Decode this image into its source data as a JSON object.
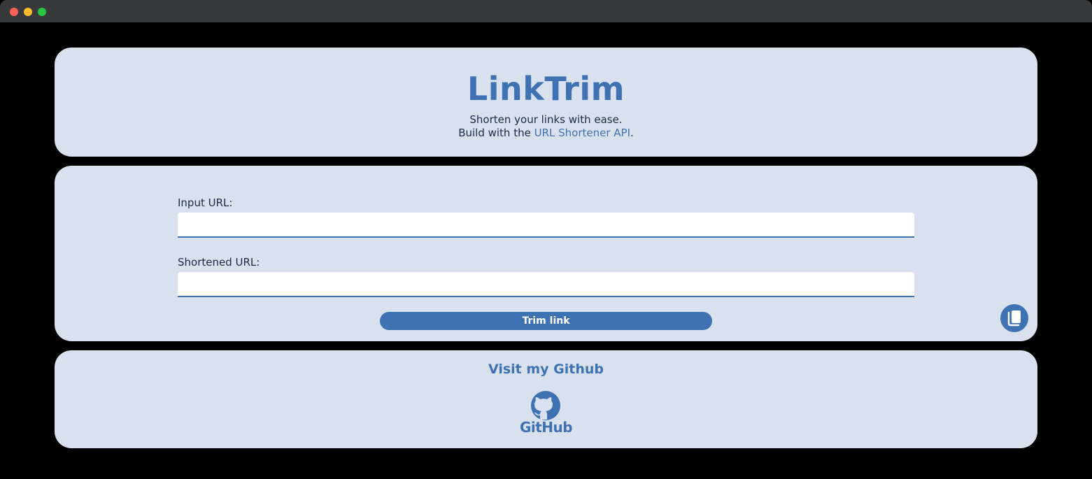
{
  "header": {
    "title": "LinkTrim",
    "tagline_line1": "Shorten your links with ease.",
    "tagline_prefix": "Build with the ",
    "api_link_label": "URL Shortener API",
    "tagline_suffix": "."
  },
  "form": {
    "input_label": "Input URL:",
    "input_value": "",
    "shortened_label": "Shortened URL:",
    "shortened_value": "",
    "trim_button_label": "Trim link",
    "copy_icon": "copy-icon"
  },
  "footer": {
    "github_link_label": "Visit my Github",
    "github_logo_icon": "github-octocat-icon",
    "github_wordmark": "GitHub"
  },
  "colors": {
    "background": "#000000",
    "card": "#dae1ee",
    "accent": "#3f72b3",
    "text": "#1c2a44"
  }
}
